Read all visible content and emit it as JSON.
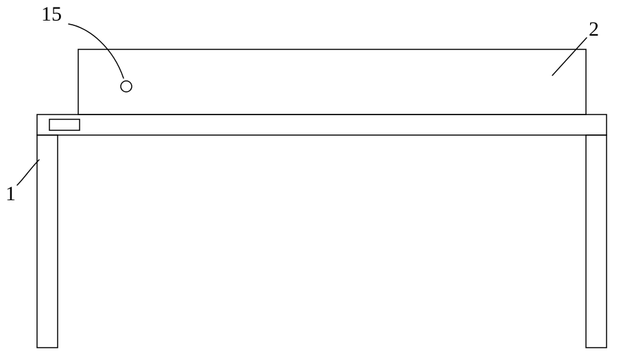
{
  "labels": {
    "label_15": "15",
    "label_2": "2",
    "label_1": "1"
  },
  "diagram": {
    "description": "Technical line drawing, front elevation. A table-like frame (part 1) with two vertical legs and a top rail; a rectangular panel (part 2) sits on top of the frame. A small circle (part 15) is on the upper panel near the left, and a small rectangle sits on the top rail near the left leg. Numbered leader lines point to parts 15, 2, and 1.",
    "parts": [
      {
        "id": "1",
        "name": "frame / table body",
        "leader_from": "left side, mid-height",
        "target": "left leg outer edge"
      },
      {
        "id": "2",
        "name": "upper rectangular panel",
        "leader_from": "top right",
        "target": "panel interior near top-right corner"
      },
      {
        "id": "15",
        "name": "small circular feature on panel",
        "leader_from": "top left",
        "target": "small circle on panel"
      }
    ],
    "stroke": "#000",
    "stroke_width": 1.5
  }
}
